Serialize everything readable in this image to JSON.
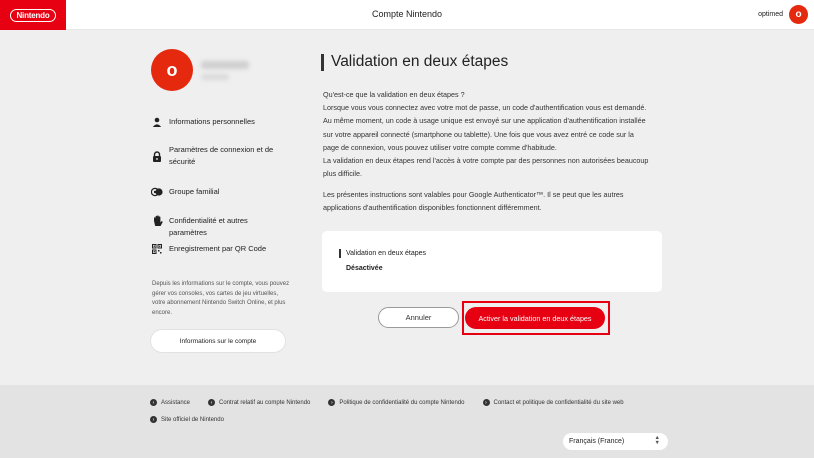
{
  "header": {
    "logo_text": "Nintendo",
    "title": "Compte Nintendo",
    "user_name": "optimed",
    "user_initial": "o"
  },
  "sidebar": {
    "profile_initial": "o",
    "items": [
      {
        "label": "Informations personnelles",
        "icon": "person-icon"
      },
      {
        "label": "Paramètres de connexion et de sécurité",
        "icon": "lock-icon"
      },
      {
        "label": "Groupe familial",
        "icon": "family-group-icon"
      },
      {
        "label": "Confidentialité et autres paramètres",
        "icon": "hand-icon"
      },
      {
        "label": "Enregistrement par QR Code",
        "icon": "qr-code-icon"
      }
    ],
    "description": "Depuis les informations sur le compte, vous pouvez gérer vos consoles, vos cartes de jeu virtuelles, votre abonnement Nintendo Switch Online, et plus encore.",
    "account_button": "Informations sur le compte"
  },
  "main": {
    "title": "Validation en deux étapes",
    "paragraph_lines": [
      "Qu'est-ce que la validation en deux étapes ?",
      "Lorsque vous vous connectez avec votre mot de passe, un code d'authentification vous est demandé.",
      "Au même moment, un code à usage unique est envoyé sur une application d'authentification installée",
      "sur votre appareil connecté (smartphone ou tablette). Une fois que vous avez entré ce code sur la",
      "page de connexion, vous pouvez utiliser votre compte comme d'habitude.",
      "La validation en deux étapes rend l'accès à votre compte par des personnes non autorisées beaucoup",
      "plus difficile."
    ],
    "paragraph2_lines": [
      "Les présentes instructions sont valables pour Google Authenticator™. Il se peut que les autres",
      "applications d'authentification disponibles fonctionnent différemment."
    ],
    "status_label": "Validation en deux étapes",
    "status_value": "Désactivée",
    "cancel_button": "Annuler",
    "activate_button": "Activer la validation en deux étapes"
  },
  "footer": {
    "links": [
      "Assistance",
      "Contrat relatif au compte Nintendo",
      "Politique de confidentialité du compte Nintendo",
      "Contact et politique de confidentialité du site web",
      "Site officiel de Nintendo"
    ],
    "language": "Français (France)"
  },
  "colors": {
    "brand_red": "#e60012",
    "avatar_red": "#e4290f",
    "background": "#efefef"
  }
}
